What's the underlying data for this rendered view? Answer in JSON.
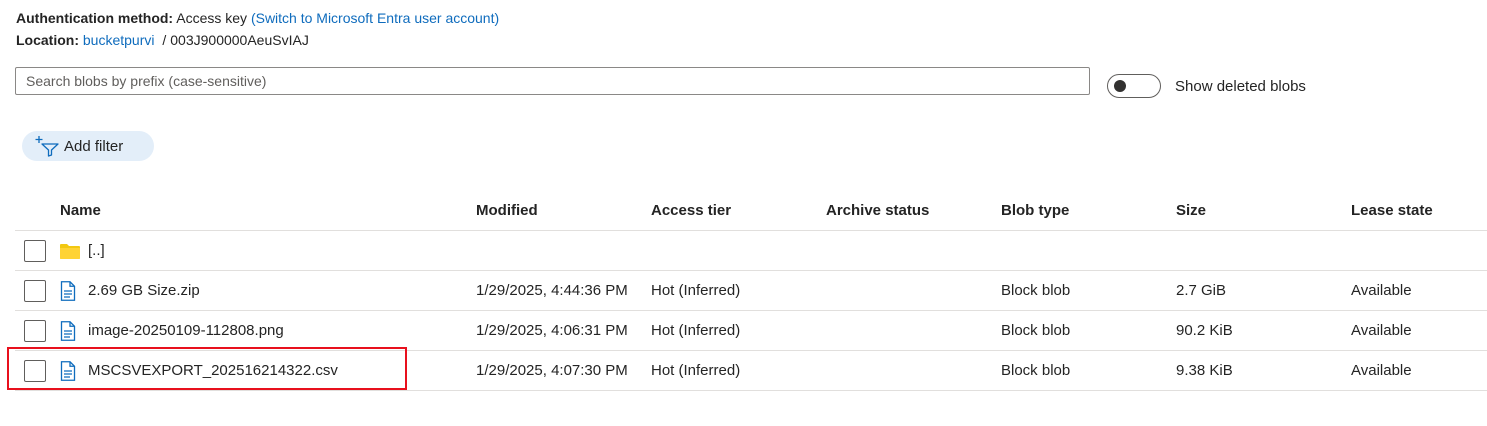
{
  "info": {
    "auth_label": "Authentication method:",
    "auth_value": "Access key",
    "auth_switch": "(Switch to Microsoft Entra user account)",
    "location_label": "Location:",
    "location_container": "bucketpurvi",
    "location_separator": "/",
    "location_path": "003J900000AeuSvIAJ"
  },
  "search": {
    "placeholder": "Search blobs by prefix (case-sensitive)",
    "value": ""
  },
  "toggle": {
    "label": "Show deleted blobs",
    "on": false
  },
  "filter": {
    "label": "Add filter"
  },
  "table": {
    "columns": [
      "Name",
      "Modified",
      "Access tier",
      "Archive status",
      "Blob type",
      "Size",
      "Lease state"
    ],
    "rows": [
      {
        "icon": "folder-icon",
        "name": "[..]",
        "modified": "",
        "tier": "",
        "archive": "",
        "type": "",
        "size": "",
        "lease": ""
      },
      {
        "icon": "file-icon",
        "name": "2.69 GB Size.zip",
        "modified": "1/29/2025, 4:44:36 PM",
        "tier": "Hot (Inferred)",
        "archive": "",
        "type": "Block blob",
        "size": "2.7 GiB",
        "lease": "Available"
      },
      {
        "icon": "file-icon",
        "name": "image-20250109-112808.png",
        "modified": "1/29/2025, 4:06:31 PM",
        "tier": "Hot (Inferred)",
        "archive": "",
        "type": "Block blob",
        "size": "90.2 KiB",
        "lease": "Available"
      },
      {
        "icon": "file-icon",
        "name": "MSCSVEXPORT_202516214322.csv",
        "modified": "1/29/2025, 4:07:30 PM",
        "tier": "Hot (Inferred)",
        "archive": "",
        "type": "Block blob",
        "size": "9.38 KiB",
        "lease": "Available"
      }
    ]
  },
  "colors": {
    "link": "#0f6cbd",
    "folder": "#f2c811",
    "file_icon": "#0f6cbd",
    "highlight": "#e8101d",
    "filter_bg": "#e3eef9"
  }
}
